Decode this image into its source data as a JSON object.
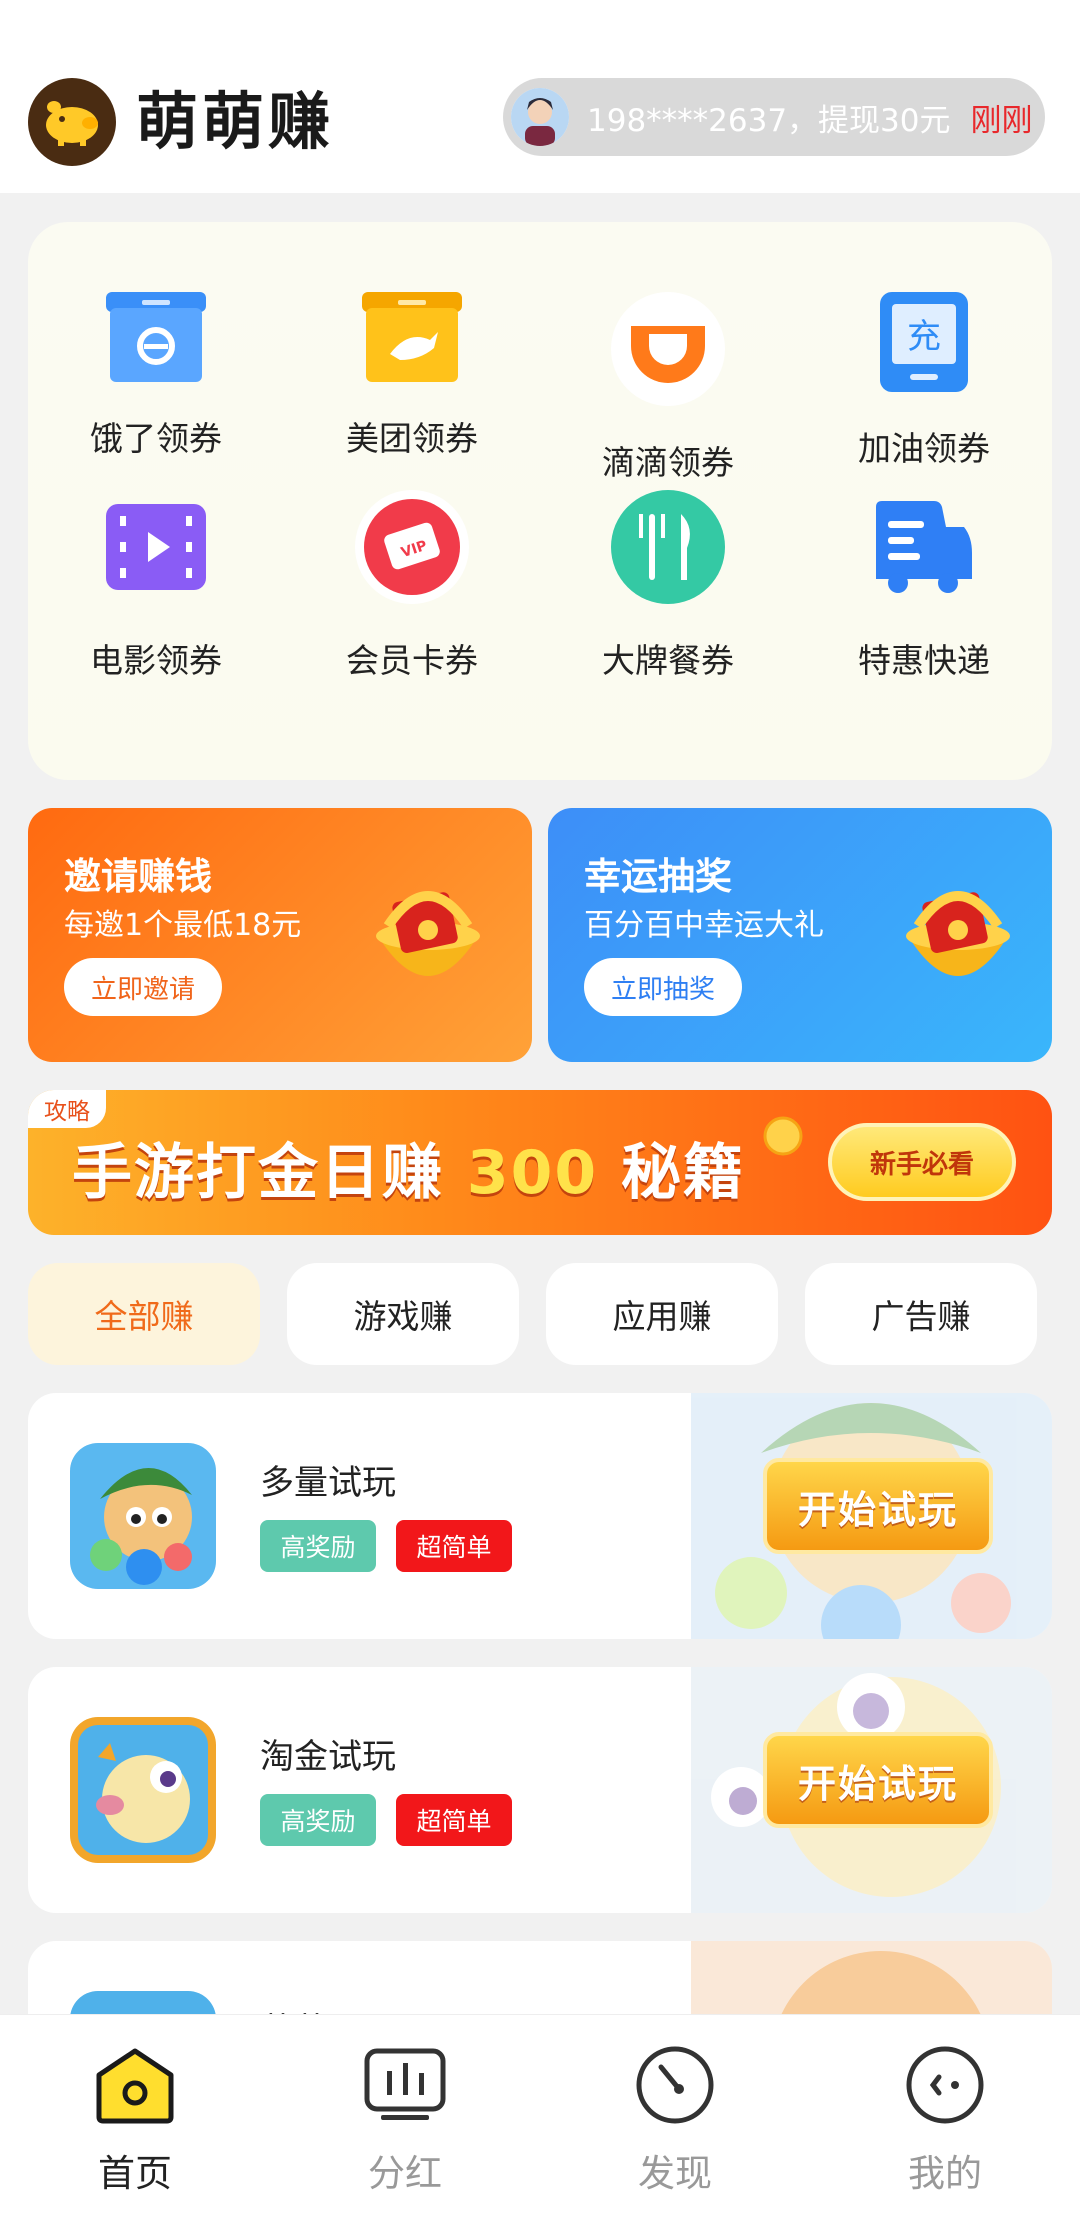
{
  "header": {
    "app_title": "萌萌赚",
    "ticker_text": "198****2637，提现30元",
    "ticker_time": "刚刚"
  },
  "coupons": [
    {
      "label": "饿了领券",
      "icon": "eleme-box-icon"
    },
    {
      "label": "美团领券",
      "icon": "meituan-kangaroo-icon"
    },
    {
      "label": "滴滴领券",
      "icon": "didi-icon"
    },
    {
      "label": "加油领券",
      "icon": "recharge-icon",
      "icon_text": "充"
    },
    {
      "label": "电影领券",
      "icon": "movie-icon"
    },
    {
      "label": "会员卡券",
      "icon": "vip-ticket-icon",
      "icon_text": "VIP"
    },
    {
      "label": "大牌餐券",
      "icon": "fork-knife-icon"
    },
    {
      "label": "特惠快递",
      "icon": "delivery-truck-icon"
    }
  ],
  "promos": {
    "invite": {
      "title": "邀请赚钱",
      "subtitle": "每邀1个最低18元",
      "button": "立即邀请"
    },
    "lottery": {
      "title": "幸运抽奖",
      "subtitle": "百分百中幸运大礼",
      "button": "立即抽奖"
    }
  },
  "banner": {
    "tag": "攻略",
    "title_a": "手游打金日赚 ",
    "title_num": "300",
    "title_b": " 秘籍",
    "button": "新手必看"
  },
  "filters": [
    "全部赚",
    "游戏赚",
    "应用赚",
    "广告赚"
  ],
  "tasks": [
    {
      "name": "多量试玩",
      "tag1": "高奖励",
      "tag2": "超简单",
      "button": "开始试玩"
    },
    {
      "name": "淘金试玩",
      "tag1": "高奖励",
      "tag2": "超简单",
      "button": "开始试玩"
    },
    {
      "name": "萌萌…",
      "tag1": "",
      "tag2": "",
      "button": ""
    }
  ],
  "tabbar": [
    "首页",
    "分红",
    "发现",
    "我的"
  ],
  "colors": {
    "accent": "#f06a1a",
    "invite_bg": "#ff7a14",
    "lottery_bg": "#2e8ff5",
    "red_tag": "#f2171a",
    "green_tag": "#5ec9ad"
  }
}
